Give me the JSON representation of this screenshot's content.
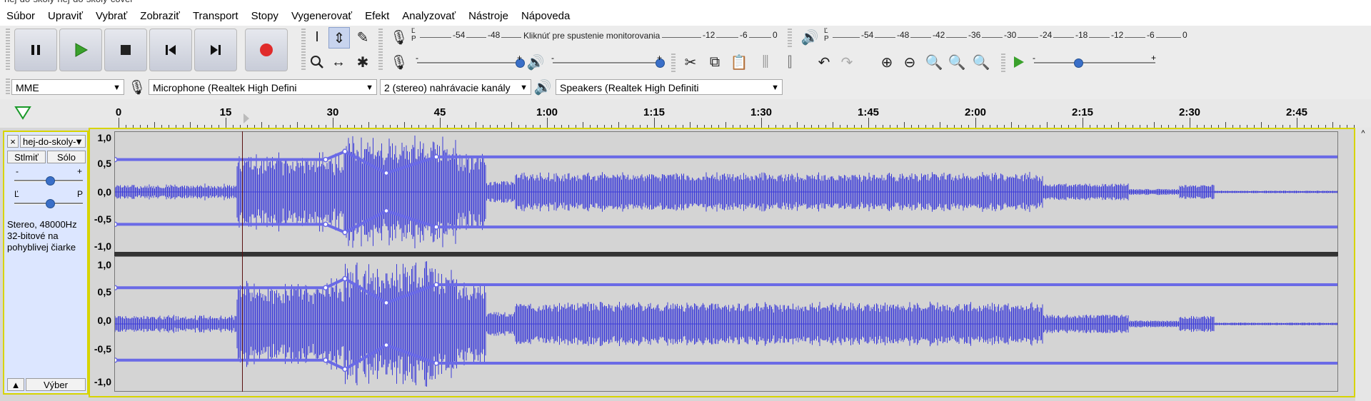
{
  "title_bar": {
    "text": "hej-do-skoly-hej-do-skoly-cover"
  },
  "menu": [
    "Súbor",
    "Upraviť",
    "Vybrať",
    "Zobraziť",
    "Transport",
    "Stopy",
    "Vygenerovať",
    "Efekt",
    "Analyzovať",
    "Nástroje",
    "Nápoveda"
  ],
  "transport": {
    "buttons": [
      "pause-icon",
      "play-icon",
      "stop-icon",
      "skip-start-icon",
      "skip-end-icon",
      "record-icon"
    ],
    "colors": {
      "play": "#3aa12c",
      "record": "#e02b2b",
      "button_bg": "#d0d4e0"
    }
  },
  "record_meter": {
    "left": "Ľ",
    "right": "P",
    "ticks": [
      "-54",
      "-48",
      "-12",
      "-6",
      "0"
    ],
    "message": "Kliknúť pre spustenie monitorovania"
  },
  "play_meter": {
    "left": "Ľ",
    "right": "P",
    "ticks": [
      "-54",
      "-48",
      "-42",
      "-36",
      "-30",
      "-24",
      "-18",
      "-12",
      "-6",
      "0"
    ]
  },
  "sliders": {
    "minus": "-",
    "plus": "+"
  },
  "device_toolbar": {
    "host": "MME",
    "microphone": "Microphone (Realtek High Defini",
    "channels": "2 (stereo) nahrávacie kanály",
    "speakers": "Speakers (Realtek High Definiti"
  },
  "timeline": {
    "labels": [
      "0",
      "15",
      "30",
      "45",
      "1:00",
      "1:15",
      "1:30",
      "1:45",
      "2:00",
      "2:15",
      "2:30",
      "2:45"
    ],
    "cursor_seconds": 17.5
  },
  "track": {
    "name": "hej-do-skoly-",
    "close": "×",
    "mute": "Stlmiť",
    "solo": "Sólo",
    "gain_minus": "-",
    "gain_plus": "+",
    "pan_left": "Ľ",
    "pan_right": "P",
    "info_line1": "Stereo, 48000Hz",
    "info_line2": "32-bitové na",
    "info_line3": "pohyblivej čiarke",
    "collapse": "▲",
    "select": "Výber",
    "waveform_color": "#3c3cd8",
    "envelope_color": "#6a6ae6"
  },
  "vruler": [
    "1,0",
    "0,5",
    "0,0",
    "-0,5",
    "-1,0"
  ]
}
